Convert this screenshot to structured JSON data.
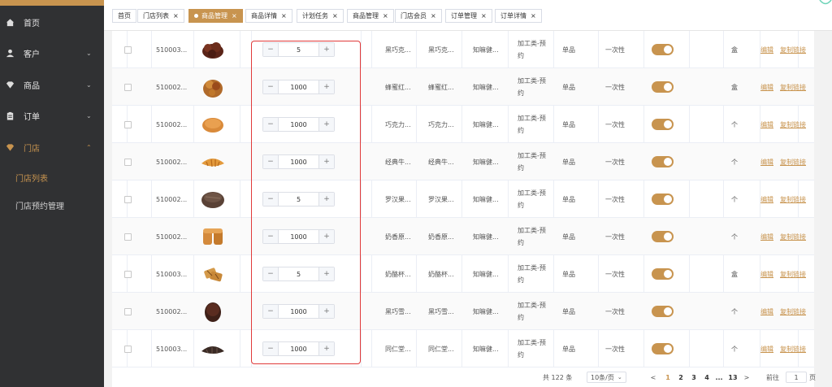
{
  "sidebar": {
    "items": [
      {
        "label": "首页",
        "icon": "home-icon"
      },
      {
        "label": "客户",
        "icon": "user-icon"
      },
      {
        "label": "商品",
        "icon": "diamond-icon"
      },
      {
        "label": "订单",
        "icon": "clipboard-icon"
      },
      {
        "label": "门店",
        "icon": "diamond-icon"
      }
    ],
    "subitems": [
      {
        "label": "门店列表"
      },
      {
        "label": "门店预约管理"
      }
    ]
  },
  "tabs": [
    {
      "label": "首页"
    },
    {
      "label": "门店列表"
    },
    {
      "label": "商品管理"
    },
    {
      "label": "商品详情"
    },
    {
      "label": "计划任务"
    },
    {
      "label": "商品管理"
    },
    {
      "label": "门店会员"
    },
    {
      "label": "订单管理"
    },
    {
      "label": "订单详情"
    }
  ],
  "close_glyph": "×",
  "table": {
    "rows": [
      {
        "id": "510003...",
        "qty": "5",
        "name1": "黑巧克...",
        "name2": "黑巧克...",
        "brand": "知嘛健...",
        "cat1": "加工类-预",
        "cat2": "约",
        "type": "单品",
        "usage": "一次性",
        "unit": "盒",
        "edit": "编辑",
        "copy": "复制链接"
      },
      {
        "id": "510002...",
        "qty": "1000",
        "name1": "蜂蜜红...",
        "name2": "蜂蜜红...",
        "brand": "知嘛健...",
        "cat1": "加工类-预",
        "cat2": "约",
        "type": "单品",
        "usage": "一次性",
        "unit": "盒",
        "edit": "编辑",
        "copy": "复制链接"
      },
      {
        "id": "510002...",
        "qty": "1000",
        "name1": "巧克力...",
        "name2": "巧克力...",
        "brand": "知嘛健...",
        "cat1": "加工类-预",
        "cat2": "约",
        "type": "单品",
        "usage": "一次性",
        "unit": "个",
        "edit": "编辑",
        "copy": "复制链接"
      },
      {
        "id": "510002...",
        "qty": "1000",
        "name1": "经典牛...",
        "name2": "经典牛...",
        "brand": "知嘛健...",
        "cat1": "加工类-预",
        "cat2": "约",
        "type": "单品",
        "usage": "一次性",
        "unit": "个",
        "edit": "编辑",
        "copy": "复制链接"
      },
      {
        "id": "510002...",
        "qty": "5",
        "name1": "罗汉果...",
        "name2": "罗汉果...",
        "brand": "知嘛健...",
        "cat1": "加工类-预",
        "cat2": "约",
        "type": "单品",
        "usage": "一次性",
        "unit": "个",
        "edit": "编辑",
        "copy": "复制链接"
      },
      {
        "id": "510002...",
        "qty": "1000",
        "name1": "奶香原...",
        "name2": "奶香原...",
        "brand": "知嘛健...",
        "cat1": "加工类-预",
        "cat2": "约",
        "type": "单品",
        "usage": "一次性",
        "unit": "个",
        "edit": "编辑",
        "copy": "复制链接"
      },
      {
        "id": "510003...",
        "qty": "5",
        "name1": "奶酪杯...",
        "name2": "奶酪杯...",
        "brand": "知嘛健...",
        "cat1": "加工类-预",
        "cat2": "约",
        "type": "单品",
        "usage": "一次性",
        "unit": "盒",
        "edit": "编辑",
        "copy": "复制链接"
      },
      {
        "id": "510002...",
        "qty": "1000",
        "name1": "黑巧雪...",
        "name2": "黑巧雪...",
        "brand": "知嘛健...",
        "cat1": "加工类-预",
        "cat2": "约",
        "type": "单品",
        "usage": "一次性",
        "unit": "个",
        "edit": "编辑",
        "copy": "复制链接"
      },
      {
        "id": "510003...",
        "qty": "1000",
        "name1": "同仁堂...",
        "name2": "同仁堂...",
        "brand": "知嘛健...",
        "cat1": "加工类-预",
        "cat2": "约",
        "type": "单品",
        "usage": "一次性",
        "unit": "个",
        "edit": "编辑",
        "copy": "复制链接"
      }
    ]
  },
  "stepper": {
    "minus": "−",
    "plus": "+"
  },
  "pagination": {
    "total": "共 122 条",
    "page_size": "10条/页",
    "prev": "<",
    "pages": [
      "1",
      "2",
      "3",
      "4",
      "...",
      "13"
    ],
    "next": ">",
    "goto_label": "前往",
    "goto_value": "1",
    "goto_suffix": "页"
  },
  "colors": {
    "accent": "#c8944f",
    "sidebar_bg": "#303133",
    "highlight_box": "#e03a3a"
  }
}
